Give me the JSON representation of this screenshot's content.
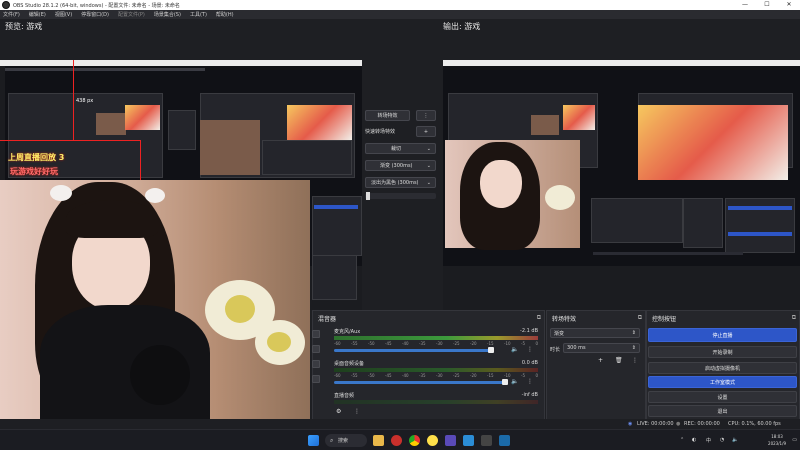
{
  "window": {
    "title": "OBS Studio 28.1.2 (64-bit, windows) - 配置文件: 未命名 - 场景: 未命名",
    "controls": [
      "—",
      "☐",
      "✕"
    ]
  },
  "menu": [
    "文件(F)",
    "编辑(E)",
    "视图(V)",
    "停靠窗口(D)",
    "配置文件(P)",
    "场景集合(S)",
    "工具(T)",
    "帮助(H)"
  ],
  "studio": {
    "preview_title": "预览: 游戏",
    "program_title": "输出: 游戏",
    "preview_size_label": "438 px"
  },
  "overlay": {
    "line1": "上周直播回放 3",
    "line2": "玩游戏好好玩"
  },
  "transitions_mid": {
    "quick_transitions_label": "快速转场特效",
    "transition_button": "转场特效",
    "items": [
      "裁切",
      "渐变 (300ms)",
      "淡出为黑色 (300ms)"
    ]
  },
  "docks": {
    "mixer": {
      "title": "混音器",
      "channels": [
        {
          "name": "麦克风/Aux",
          "db": "-2.1 dB",
          "level": 0.93
        },
        {
          "name": "桌面音频设备",
          "db": "0.0 dB",
          "level": 1.0
        },
        {
          "name": "直播音频",
          "db": "-inf dB",
          "level": 0
        }
      ],
      "ticks": [
        "-60",
        "-55",
        "-50",
        "-45",
        "-40",
        "-35",
        "-30",
        "-25",
        "-20",
        "-15",
        "-10",
        "-5",
        "0"
      ]
    },
    "transitions": {
      "title": "转场特效",
      "selected": "渐变",
      "duration_label": "时长",
      "duration_value": "300 ms"
    },
    "controls": {
      "title": "控制按钮",
      "buttons": [
        "停止直播",
        "开始录制",
        "启动虚拟摄像机",
        "工作室模式",
        "设置",
        "退出"
      ]
    }
  },
  "status": {
    "live": "LIVE: 00:00:00",
    "rec": "REC: 00:00:00",
    "cpu": "CPU: 0.1%, 60.00 fps"
  },
  "taskbar": {
    "search": "搜索",
    "tray_ime": "中",
    "time": "18:03",
    "date": "2023/1/9"
  },
  "colors": {
    "accent": "#2d56c8",
    "panel": "#25262b",
    "background": "#1e1f23"
  }
}
